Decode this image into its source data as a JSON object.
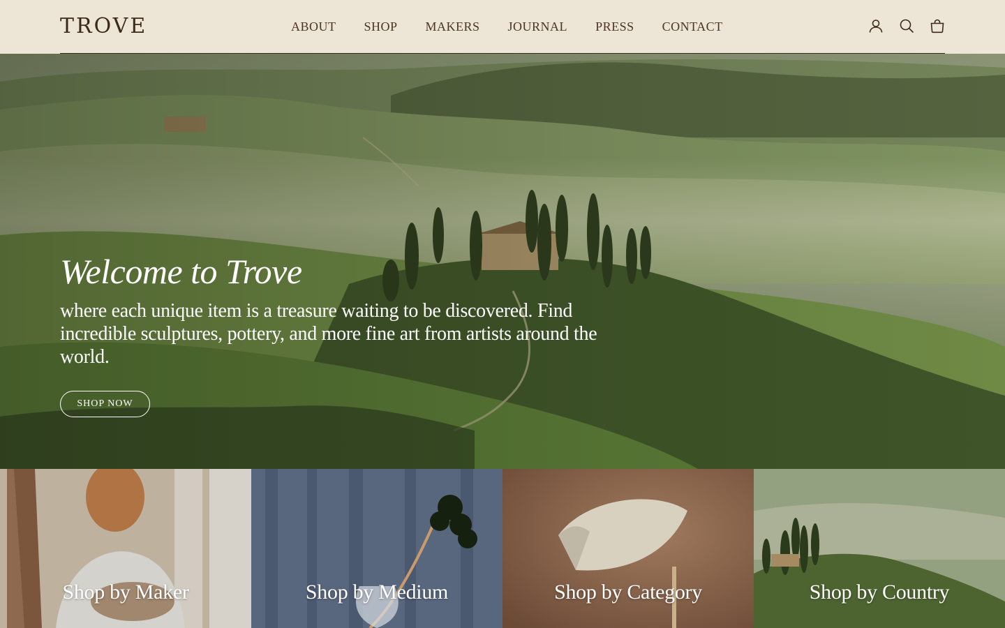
{
  "brand": {
    "name": "TROVE"
  },
  "nav": {
    "items": [
      {
        "label": "ABOUT"
      },
      {
        "label": "SHOP"
      },
      {
        "label": "MAKERS"
      },
      {
        "label": "JOURNAL"
      },
      {
        "label": "PRESS"
      },
      {
        "label": "CONTACT"
      }
    ]
  },
  "header_icons": [
    "account-icon",
    "search-icon",
    "cart-icon"
  ],
  "hero": {
    "title": "Welcome to Trove",
    "subtitle": "where each unique item is a treasure waiting to be discovered. Find incredible sculptures, pottery, and more fine art from artists around the world.",
    "cta_label": "SHOP NOW"
  },
  "tiles": [
    {
      "label": "Shop by Maker"
    },
    {
      "label": "Shop by Medium"
    },
    {
      "label": "Shop by Category"
    },
    {
      "label": "Shop by Country"
    }
  ],
  "colors": {
    "header_bg": "#ede5d6",
    "text_dark": "#3b2a1a",
    "hero_text": "#ffffff"
  }
}
